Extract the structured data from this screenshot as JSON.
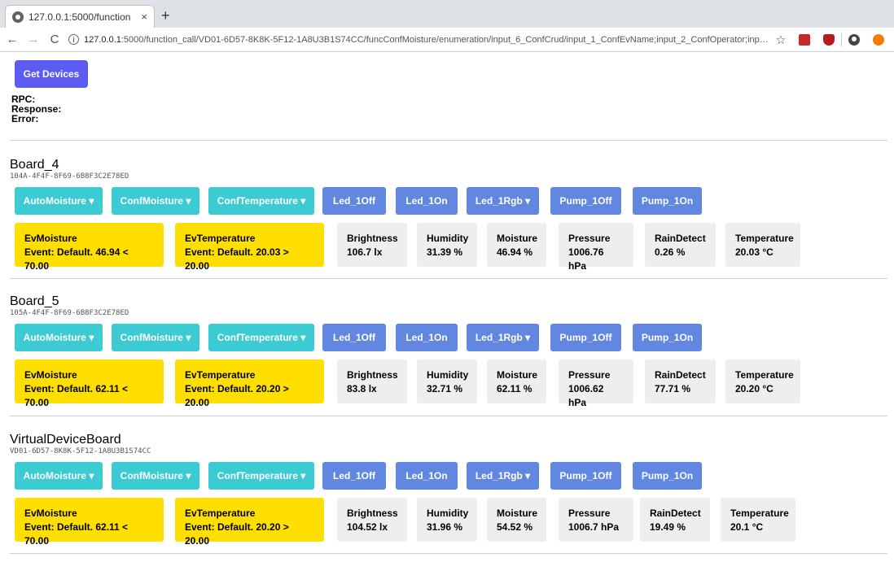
{
  "browser": {
    "tab_title": "127.0.0.1:5000/function",
    "tab_close": "×",
    "new_tab": "+",
    "url_host": "127.0.0.1",
    "url_rest": ":5000/function_call/VD01-6D57-8K8K-5F12-1A8U3B1S74CC/funcConfMoisture/enumeration/input_6_ConfCrud/input_1_ConfEvName;input_2_ConfOperator;input_3_ConfMoistur..."
  },
  "header": {
    "get_devices_label": "Get Devices",
    "rpc_label": "RPC:",
    "response_label": "Response:",
    "error_label": "Error:"
  },
  "boards": [
    {
      "name": "Board_4",
      "id": "104A-4F4F-8F69-6B8F3C2E78ED",
      "buttons": [
        "AutoMoisture ▾",
        "ConfMoisture ▾",
        "ConfTemperature ▾",
        "Led_1Off",
        "Led_1On",
        "Led_1Rgb ▾",
        "Pump_1Off",
        "Pump_1On"
      ],
      "events": [
        {
          "title": "EvMoisture",
          "value": "Event: Default. 46.94 < 70.00"
        },
        {
          "title": "EvTemperature",
          "value": "Event: Default. 20.03 > 20.00"
        }
      ],
      "sensors": [
        {
          "title": "Brightness",
          "value": "106.7 lx"
        },
        {
          "title": "Humidity",
          "value": "31.39 %"
        },
        {
          "title": "Moisture",
          "value": "46.94 %"
        },
        {
          "title": "Pressure",
          "value": "1006.76 hPa"
        },
        {
          "title": "RainDetect",
          "value": "0.26 %"
        },
        {
          "title": "Temperature",
          "value": "20.03 °C"
        }
      ]
    },
    {
      "name": "Board_5",
      "id": "105A-4F4F-8F69-6B8F3C2E78ED",
      "buttons": [
        "AutoMoisture ▾",
        "ConfMoisture ▾",
        "ConfTemperature ▾",
        "Led_1Off",
        "Led_1On",
        "Led_1Rgb ▾",
        "Pump_1Off",
        "Pump_1On"
      ],
      "events": [
        {
          "title": "EvMoisture",
          "value": "Event: Default. 62.11 < 70.00"
        },
        {
          "title": "EvTemperature",
          "value": "Event: Default. 20.20 > 20.00"
        }
      ],
      "sensors": [
        {
          "title": "Brightness",
          "value": "83.8 lx"
        },
        {
          "title": "Humidity",
          "value": "32.71 %"
        },
        {
          "title": "Moisture",
          "value": "62.11 %"
        },
        {
          "title": "Pressure",
          "value": "1006.62 hPa"
        },
        {
          "title": "RainDetect",
          "value": "77.71 %"
        },
        {
          "title": "Temperature",
          "value": "20.20 °C"
        }
      ]
    },
    {
      "name": "VirtualDeviceBoard",
      "id": "VD01-6D57-8K8K-5F12-1A8U3B1S74CC",
      "buttons": [
        "AutoMoisture ▾",
        "ConfMoisture ▾",
        "ConfTemperature ▾",
        "Led_1Off",
        "Led_1On",
        "Led_1Rgb ▾",
        "Pump_1Off",
        "Pump_1On"
      ],
      "events": [
        {
          "title": "EvMoisture",
          "value": "Event: Default. 62.11 < 70.00"
        },
        {
          "title": "EvTemperature",
          "value": "Event: Default. 20.20 > 20.00"
        }
      ],
      "sensors": [
        {
          "title": "Brightness",
          "value": "104.52 lx"
        },
        {
          "title": "Humidity",
          "value": "31.96 %"
        },
        {
          "title": "Moisture",
          "value": "54.52 %"
        },
        {
          "title": "Pressure",
          "value": "1006.7 hPa"
        },
        {
          "title": "RainDetect",
          "value": "19.49 %"
        },
        {
          "title": "Temperature",
          "value": "20.1 °C"
        }
      ]
    }
  ]
}
